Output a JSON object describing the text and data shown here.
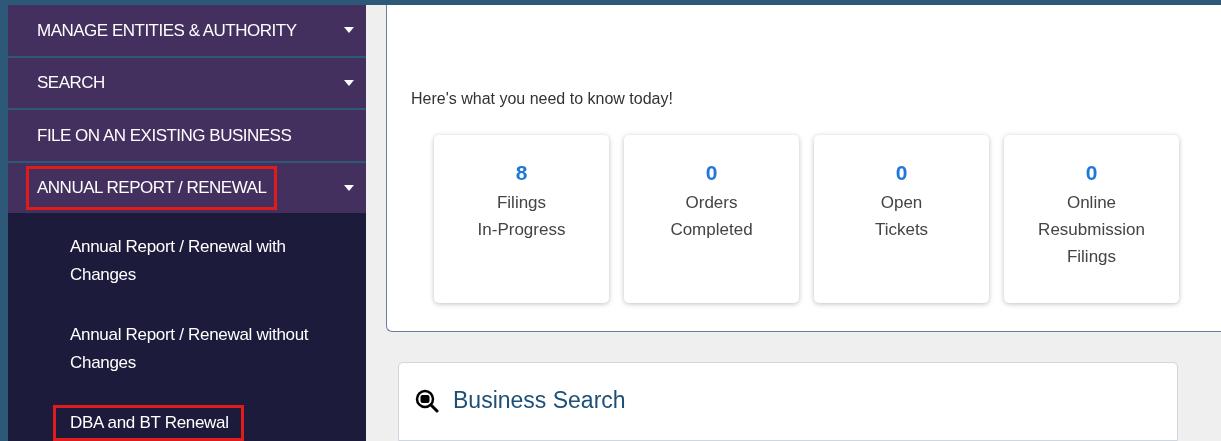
{
  "sidebar": {
    "items": [
      {
        "label": "MANAGE ENTITIES & AUTHORITY",
        "has_dropdown": true,
        "highlighted": false
      },
      {
        "label": "SEARCH",
        "has_dropdown": true,
        "highlighted": false
      },
      {
        "label": "FILE ON AN EXISTING BUSINESS",
        "has_dropdown": false,
        "highlighted": false
      },
      {
        "label": "ANNUAL REPORT / RENEWAL",
        "has_dropdown": true,
        "highlighted": true,
        "children": [
          {
            "label": "Annual Report / Renewal with Changes",
            "highlighted": false
          },
          {
            "label": "Annual Report / Renewal without Changes",
            "highlighted": false
          },
          {
            "label": "DBA and BT Renewal",
            "highlighted": true
          }
        ]
      }
    ]
  },
  "dashboard": {
    "intro": "Here's what you need to know today!",
    "stats": [
      {
        "count": "8",
        "label_lines": [
          "Filings",
          "In-Progress"
        ]
      },
      {
        "count": "0",
        "label_lines": [
          "Orders",
          "Completed"
        ]
      },
      {
        "count": "0",
        "label_lines": [
          "Open",
          "Tickets"
        ]
      },
      {
        "count": "0",
        "label_lines": [
          "Online",
          "Resubmission",
          "Filings"
        ]
      }
    ]
  },
  "business_search": {
    "title": "Business Search"
  }
}
